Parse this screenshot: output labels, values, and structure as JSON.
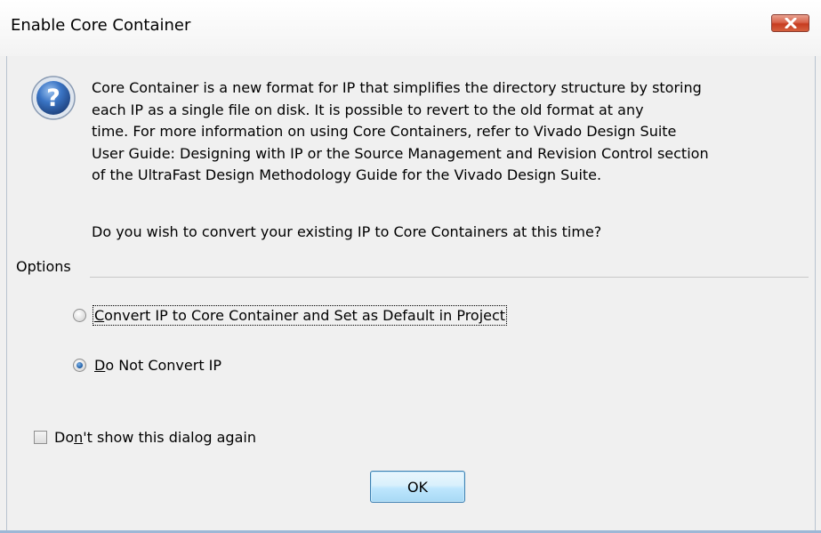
{
  "dialog": {
    "title": "Enable Core Container",
    "message": "Core Container is a new format for IP that simplifies the directory structure by storing\neach IP as a single file on disk. It is possible to revert to the old format at any\ntime. For more information on using Core Containers, refer to Vivado Design Suite\nUser Guide: Designing with IP or the Source Management and Revision Control section\nof the UltraFast Design Methodology Guide for the Vivado Design Suite.",
    "question": "Do you wish to convert your existing IP to Core Containers at this time?",
    "close_icon": "close-icon",
    "question_icon": "question-icon"
  },
  "options": {
    "label": "Options",
    "items": [
      {
        "label_prefix": "",
        "label_key": "C",
        "label_rest": "onvert IP to Core Container and Set as Default in Project",
        "selected": false
      },
      {
        "label_prefix": "",
        "label_key": "D",
        "label_rest": "o Not Convert IP",
        "selected": true
      }
    ]
  },
  "dont_show": {
    "label_prefix": "Do",
    "label_key": "n",
    "label_rest": "'t show this dialog again",
    "checked": false
  },
  "buttons": {
    "ok_label": "OK"
  },
  "colors": {
    "close_button": "#c73c20",
    "ok_border": "#3c7fb1",
    "radio_dot": "#1f5fa8",
    "question_icon": "#2a5ea8"
  }
}
